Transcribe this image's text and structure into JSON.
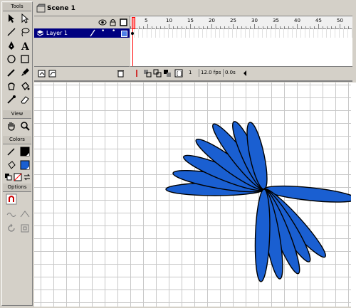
{
  "tools": {
    "header": "Tools",
    "view_header": "View",
    "colors_header": "Colors",
    "options_header": "Options",
    "items": [
      "arrow-tool",
      "subselect-tool",
      "line-tool",
      "lasso-tool",
      "pen-tool",
      "text-tool",
      "oval-tool",
      "rectangle-tool",
      "pencil-tool",
      "brush-tool",
      "ink-bottle-tool",
      "paint-bucket-tool",
      "eyedropper-tool",
      "eraser-tool"
    ],
    "stroke_color": "#000000",
    "fill_color": "#1a5fd1"
  },
  "scene": {
    "label": "Scene 1"
  },
  "timeline": {
    "layer_name": "Layer 1",
    "frame_numbers": [
      "5",
      "10",
      "15",
      "20",
      "25",
      "30",
      "35",
      "40",
      "45",
      "50"
    ],
    "current_frame": "1",
    "fps": "12.0 fps",
    "time": "0.0s"
  },
  "colors": {
    "shape_fill": "#1a5fd1",
    "shape_stroke": "#000000",
    "selected_layer": "#000080",
    "playhead": "#ff0000"
  }
}
